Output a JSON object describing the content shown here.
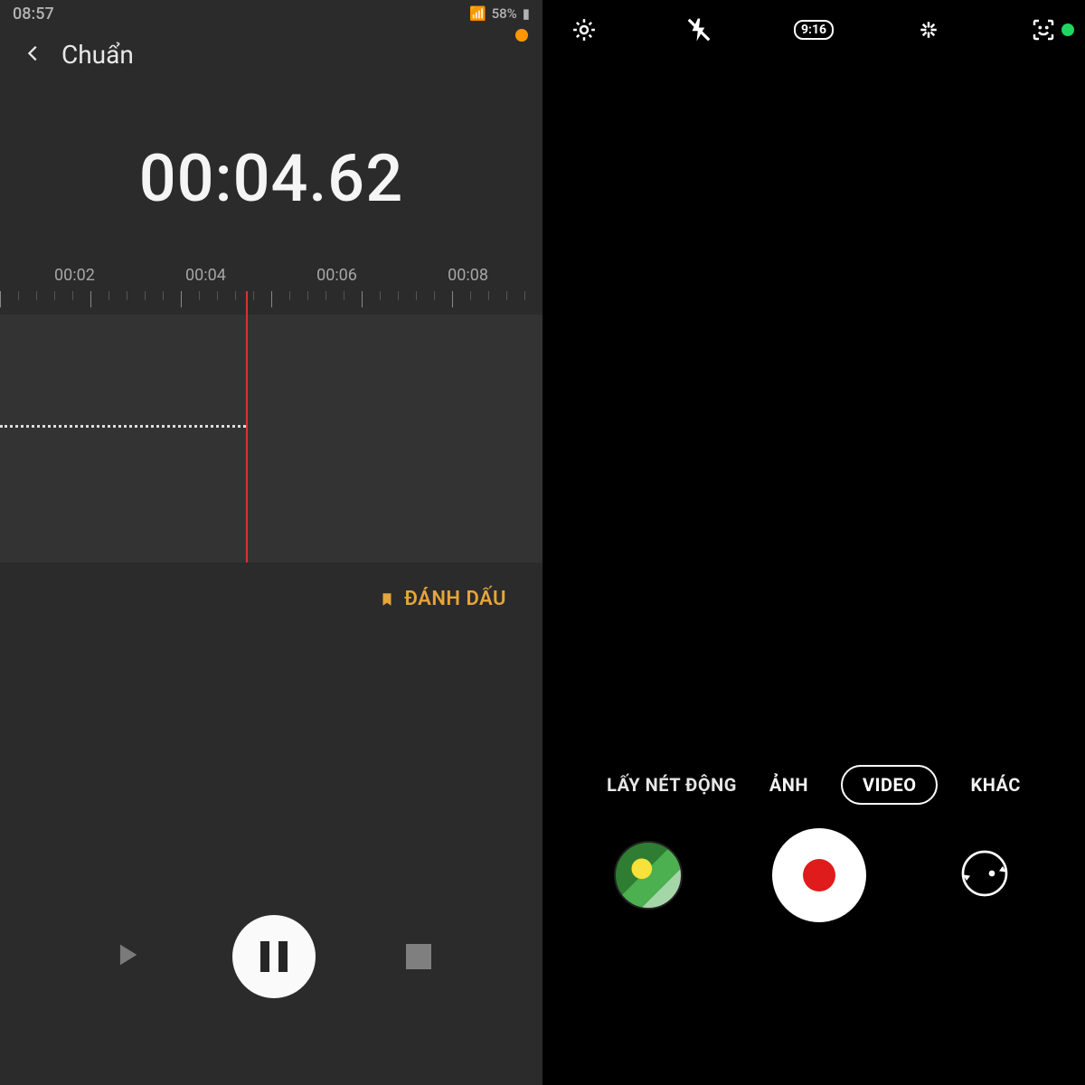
{
  "left": {
    "status": {
      "time": "08:57",
      "battery": "58%"
    },
    "title": "Chuẩn",
    "timer": "00:04.62",
    "ticks": [
      "00:02",
      "00:04",
      "00:06",
      "00:08"
    ],
    "bookmark_label": "ĐÁNH DẤU",
    "indicator_color": "#ff9800"
  },
  "right": {
    "aspect_label": "9:16",
    "modes": {
      "focus": "LẤY NÉT ĐỘNG",
      "photo": "ẢNH",
      "video": "VIDEO",
      "more": "KHÁC"
    },
    "indicator_color": "#1ed760"
  }
}
